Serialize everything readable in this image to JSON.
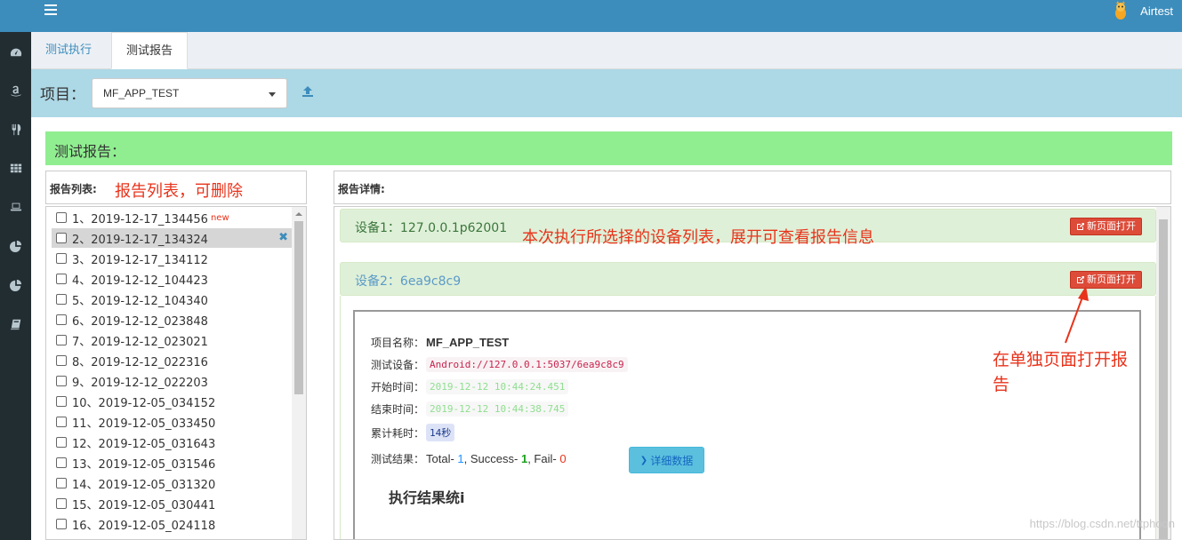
{
  "app": {
    "brand_name": "Airtest"
  },
  "tabs": [
    {
      "label": "测试执行",
      "active": false
    },
    {
      "label": "测试报告",
      "active": true
    }
  ],
  "project_bar": {
    "label": "项目：",
    "selected": "MF_APP_TEST"
  },
  "section_title": "测试报告：",
  "report_list": {
    "header": "报告列表:",
    "annotation": "报告列表，可删除",
    "new_badge": "new",
    "items": [
      {
        "label": "1、2019-12-17_134456",
        "is_new": true,
        "selected": false
      },
      {
        "label": "2、2019-12-17_134324",
        "is_new": false,
        "selected": true
      },
      {
        "label": "3、2019-12-17_134112",
        "is_new": false,
        "selected": false
      },
      {
        "label": "4、2019-12-12_104423",
        "is_new": false,
        "selected": false
      },
      {
        "label": "5、2019-12-12_104340",
        "is_new": false,
        "selected": false
      },
      {
        "label": "6、2019-12-12_023848",
        "is_new": false,
        "selected": false
      },
      {
        "label": "7、2019-12-12_023021",
        "is_new": false,
        "selected": false
      },
      {
        "label": "8、2019-12-12_022316",
        "is_new": false,
        "selected": false
      },
      {
        "label": "9、2019-12-12_022203",
        "is_new": false,
        "selected": false
      },
      {
        "label": "10、2019-12-05_034152",
        "is_new": false,
        "selected": false
      },
      {
        "label": "11、2019-12-05_033450",
        "is_new": false,
        "selected": false
      },
      {
        "label": "12、2019-12-05_031643",
        "is_new": false,
        "selected": false
      },
      {
        "label": "13、2019-12-05_031546",
        "is_new": false,
        "selected": false
      },
      {
        "label": "14、2019-12-05_031320",
        "is_new": false,
        "selected": false
      },
      {
        "label": "15、2019-12-05_030441",
        "is_new": false,
        "selected": false
      },
      {
        "label": "16、2019-12-05_024118",
        "is_new": false,
        "selected": false
      }
    ]
  },
  "report_detail": {
    "header": "报告详情:",
    "devices": [
      {
        "title": "设备1：127.0.0.1p62001",
        "open_label": "新页面打开"
      },
      {
        "title": "设备2：6ea9c8c9",
        "open_label": "新页面打开"
      }
    ],
    "report": {
      "project_key": "项目名称：",
      "project_value": "MF_APP_TEST",
      "device_key": "测试设备：",
      "device_value": "Android://127.0.0.1:5037/6ea9c8c9",
      "start_key": "开始时间：",
      "start_value": "2019-12-12 10:44:24.451",
      "end_key": "结束时间：",
      "end_value": "2019-12-12 10:44:38.745",
      "duration_key": "累计耗时：",
      "duration_value": "14秒",
      "result_key": "测试结果：",
      "total_label": "Total- ",
      "total_value": "1",
      "success_label": ", Success- ",
      "success_value": "1",
      "fail_label": ", Fail- ",
      "fail_value": "0",
      "detail_button": "详细数据",
      "stats_title": "执行结果统i"
    }
  },
  "annotations": {
    "devices_note": "本次执行所选择的设备列表，展开可查看报告信息",
    "open_note": "在单独页面打开报告"
  },
  "watermark": "https://blog.csdn.net/ttphoon",
  "colors": {
    "navbar": "#3c8dbc",
    "rail": "#222d32",
    "project_bar": "#add8e6",
    "section_title": "#90ee90",
    "device_panel": "#dff0d8",
    "open_button": "#dd4b39",
    "annotation": "#e8331b"
  },
  "icons": {
    "rail": [
      "dashboard-icon",
      "amazon-icon",
      "cutlery-icon",
      "grid-icon",
      "laptop-icon",
      "pie-chart-icon",
      "pie-chart-icon",
      "book-icon"
    ],
    "menu": "bars-icon",
    "upload": "upload-icon",
    "open": "external-link-icon",
    "delete": "close-icon",
    "expand": "chevron-down-icon"
  }
}
